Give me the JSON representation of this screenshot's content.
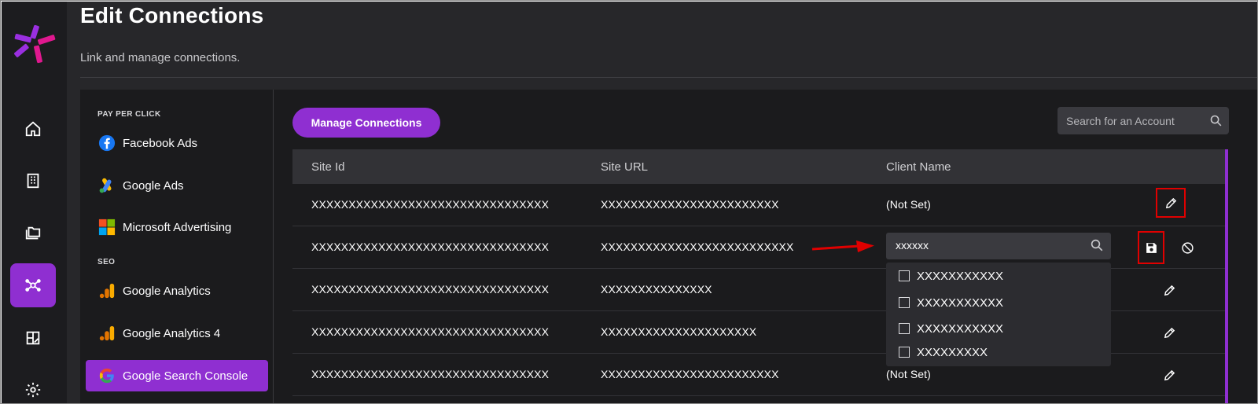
{
  "page": {
    "title": "Edit Connections",
    "subtitle": "Link and manage connections."
  },
  "nav": {
    "items": [
      {
        "icon": "home-icon"
      },
      {
        "icon": "building-icon"
      },
      {
        "icon": "folders-icon"
      },
      {
        "icon": "connections-icon",
        "active": true
      },
      {
        "icon": "reports-icon"
      },
      {
        "icon": "gear-icon"
      }
    ]
  },
  "sidebar": {
    "sections": [
      {
        "label": "PAY PER CLICK",
        "items": [
          {
            "label": "Facebook Ads",
            "icon": "facebook-icon"
          },
          {
            "label": "Google Ads",
            "icon": "google-ads-icon"
          },
          {
            "label": "Microsoft Advertising",
            "icon": "microsoft-icon"
          }
        ]
      },
      {
        "label": "SEO",
        "items": [
          {
            "label": "Google Analytics",
            "icon": "google-analytics-icon"
          },
          {
            "label": "Google Analytics 4",
            "icon": "google-analytics-4-icon"
          },
          {
            "label": "Google Search Console",
            "icon": "google-icon",
            "active": true
          }
        ]
      }
    ]
  },
  "toolbar": {
    "manage_label": "Manage Connections",
    "search_placeholder": "Search for an Account"
  },
  "table": {
    "columns": [
      "Site Id",
      "Site URL",
      "Client Name"
    ],
    "rows": [
      {
        "site_id": "XXXXXXXXXXXXXXXXXXXXXXXXXXXXXXXX",
        "site_url": "XXXXXXXXXXXXXXXXXXXXXXXX",
        "client": "(Not Set)",
        "actions": [
          "edit"
        ],
        "edit_highlighted": true
      },
      {
        "site_id": "XXXXXXXXXXXXXXXXXXXXXXXXXXXXXXXX",
        "site_url": "XXXXXXXXXXXXXXXXXXXXXXXXXX",
        "client": "",
        "editing": true,
        "actions": [
          "save",
          "cancel"
        ],
        "save_highlighted": true
      },
      {
        "site_id": "XXXXXXXXXXXXXXXXXXXXXXXXXXXXXXXX",
        "site_url": "XXXXXXXXXXXXXXX",
        "client": "",
        "actions": [
          "edit"
        ]
      },
      {
        "site_id": "XXXXXXXXXXXXXXXXXXXXXXXXXXXXXXXX",
        "site_url": "XXXXXXXXXXXXXXXXXXXXX",
        "client": "",
        "actions": [
          "edit"
        ]
      },
      {
        "site_id": "XXXXXXXXXXXXXXXXXXXXXXXXXXXXXXXX",
        "site_url": "XXXXXXXXXXXXXXXXXXXXXXXX",
        "client": "(Not Set)",
        "actions": [
          "edit"
        ]
      }
    ]
  },
  "client_editor": {
    "value": "xxxxxx",
    "options": [
      "XXXXXXXXXXX",
      "XXXXXXXXXXX",
      "XXXXXXXXXXX",
      "XXXXXXXXX"
    ]
  },
  "colors": {
    "accent": "#8f2fd1",
    "annotation": "#e00000",
    "background": "#1b1b1d"
  }
}
